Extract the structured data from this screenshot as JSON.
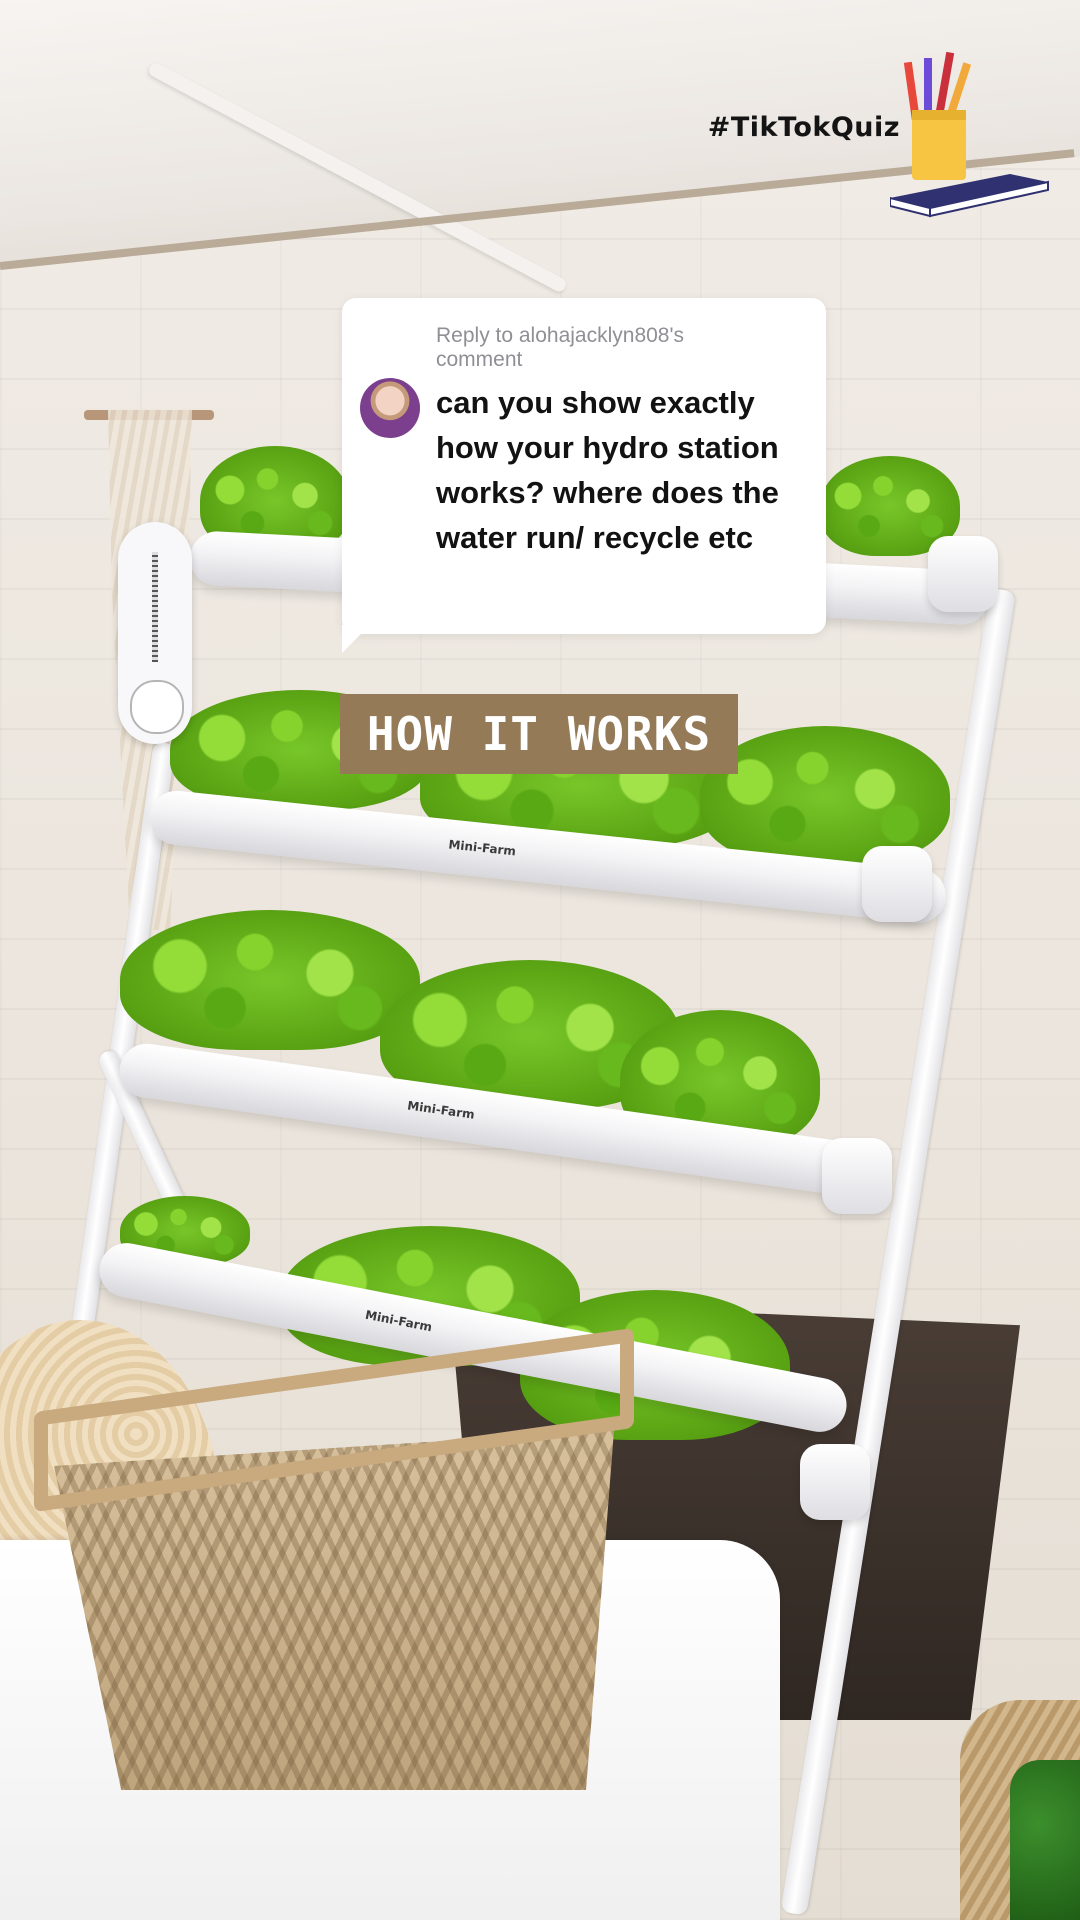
{
  "overlay": {
    "brand_tag": "#TikTokQuiz",
    "reply_prefix": "Reply to alohajacklyn808's comment",
    "comment_text": "can you show exactly how your hydro station works? where does the water run/ recycle etc",
    "label_text": "HOW IT WORKS"
  },
  "pipes": [
    {
      "label": ""
    },
    {
      "label": "Mini-Farm"
    },
    {
      "label": "Mini-Farm"
    },
    {
      "label": "Mini-Farm"
    }
  ],
  "colors": {
    "label_bg": "#957a57",
    "lettuce_green": "#7ec23a",
    "bubble_bg": "#ffffff"
  },
  "icons": {
    "brand_art": "pencil-cup-book-icon",
    "avatar": "user-avatar"
  }
}
